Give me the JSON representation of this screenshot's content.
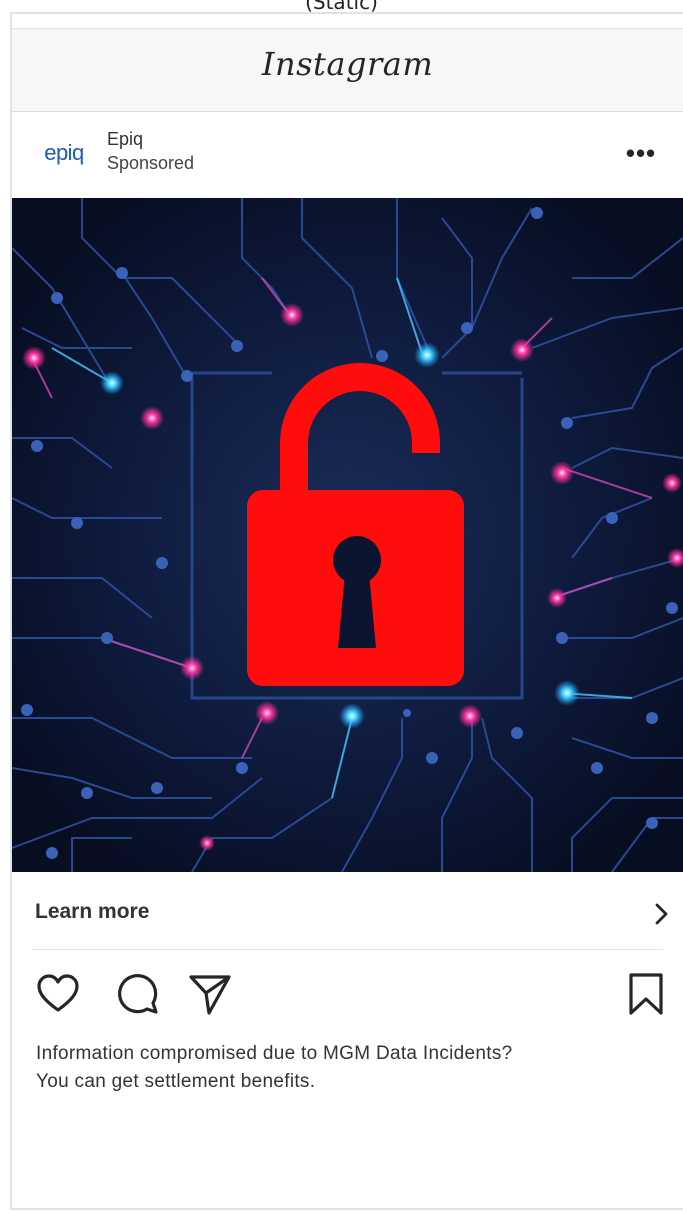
{
  "page": {
    "top_caption": "(Static)"
  },
  "app": {
    "title": "Instagram"
  },
  "post": {
    "account_avatar_text": "epiq",
    "account_name": "Epiq",
    "account_sub": "Sponsored",
    "more_label": "•••",
    "image_icon": "unlocked-padlock-circuit-image",
    "cta_label": "Learn more",
    "caption_line1": "Information compromised due to MGM Data Incidents?",
    "caption_line2": "You can get settlement benefits."
  },
  "icons": {
    "like": "heart-icon",
    "comment": "comment-icon",
    "share": "send-icon",
    "save": "bookmark-icon",
    "cta": "chevron-right-icon"
  },
  "colors": {
    "brand_blue": "#1d5bb8",
    "lock_red": "#ff0d0d",
    "image_bg": "#0b1530"
  }
}
